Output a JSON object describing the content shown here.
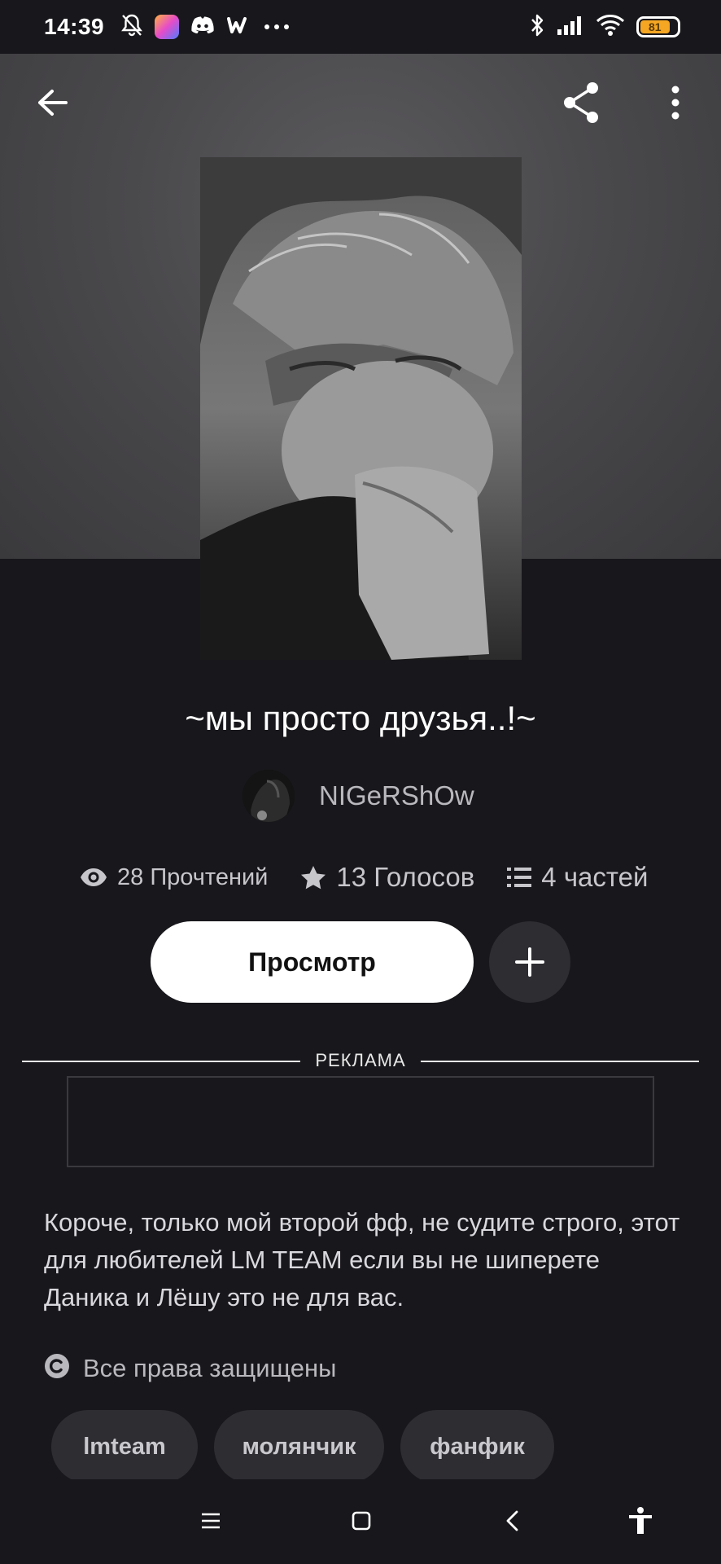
{
  "status_bar": {
    "time": "14:39",
    "battery_level": "81",
    "left_icons": [
      "bell-off-icon",
      "app-icon",
      "discord-icon",
      "wattpad-icon",
      "more-dots-icon"
    ],
    "right_icons": [
      "bluetooth-icon",
      "signal-icon",
      "wifi-icon",
      "battery-icon"
    ]
  },
  "toolbar": {
    "back_icon": "arrow-left-icon",
    "share_icon": "share-icon",
    "more_icon": "more-vertical-icon"
  },
  "story": {
    "title": "~мы просто друзья..!~",
    "author": "NIGeRShOw",
    "stats": {
      "reads": "28 Прочтений",
      "votes": "13 Голосов",
      "parts": "4 частей"
    },
    "read_button": "Просмотр",
    "description": "Короче, только мой второй фф, не судите строго, этот для любителей LM TEAM если вы не шиперете Даника и Лёшу это не для вас.",
    "rights": "Все права защищены",
    "tags": [
      "lmteam",
      "молянчик",
      "фанфик"
    ]
  },
  "ad": {
    "label": "РЕКЛАМА"
  },
  "nav_bar": {
    "icons": [
      "menu-icon",
      "home-square-icon",
      "back-chevron-icon",
      "accessibility-icon"
    ]
  },
  "colors": {
    "background": "#18171b",
    "hero": "#4a494c",
    "pill": "#2e2d32",
    "battery": "#f5a623"
  }
}
